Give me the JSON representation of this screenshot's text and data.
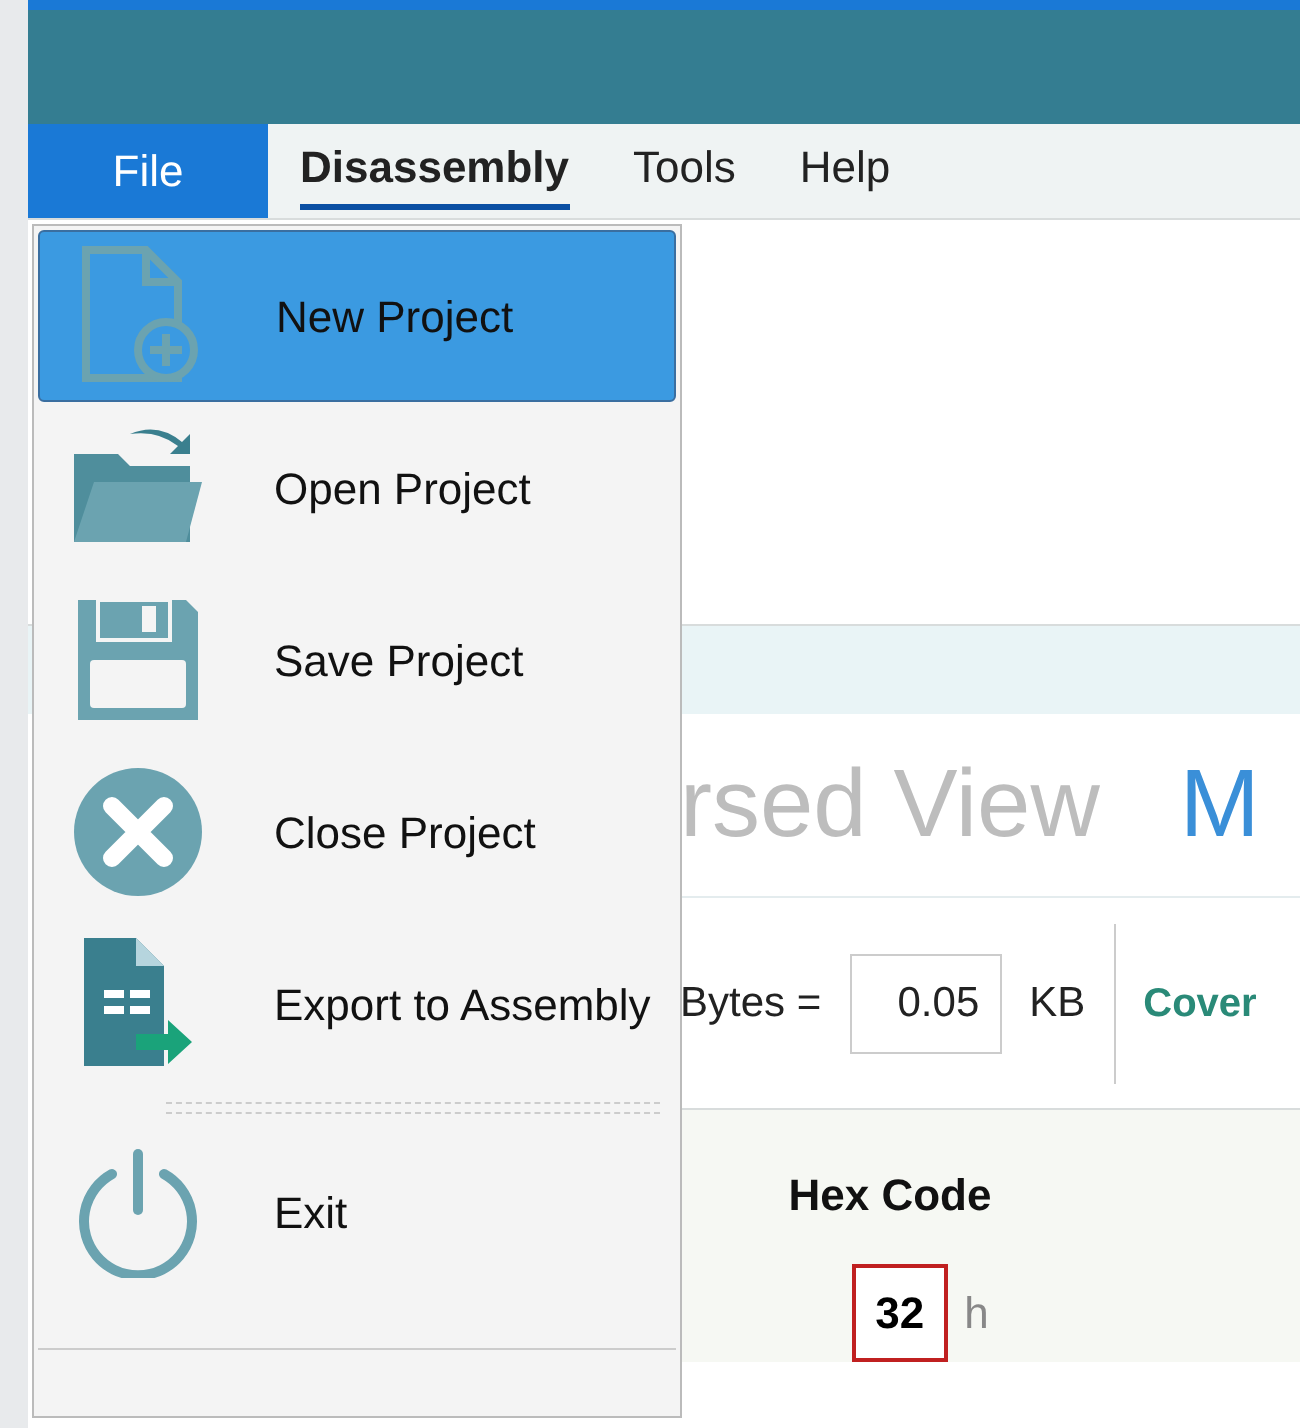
{
  "menu_bar": [
    {
      "label": "File",
      "kind": "file",
      "selected": true
    },
    {
      "label": "Disassembly",
      "kind": "tab",
      "selected": true
    },
    {
      "label": "Tools",
      "kind": "tab",
      "selected": false
    },
    {
      "label": "Help",
      "kind": "tab",
      "selected": false
    }
  ],
  "file_menu": [
    {
      "label": "New Project",
      "kind": "new",
      "selected": true
    },
    {
      "label": "Open Project",
      "kind": "open",
      "selected": false
    },
    {
      "label": "Save Project",
      "kind": "save",
      "selected": false
    },
    {
      "label": "Close Project",
      "kind": "close",
      "selected": false
    },
    {
      "label": "Export to Assembly",
      "kind": "export",
      "selected": false
    },
    {
      "label": "Exit",
      "kind": "exit",
      "selected": false
    }
  ],
  "view_tabs": [
    {
      "label": "rsed View",
      "selected": false
    },
    {
      "label": "M",
      "selected": true
    }
  ],
  "size_row": {
    "label": "Bytes =",
    "value": "0.05",
    "unit": "KB",
    "link": "Cover"
  },
  "hex": {
    "heading": "Hex Code",
    "value": "32",
    "suffix": "h"
  }
}
